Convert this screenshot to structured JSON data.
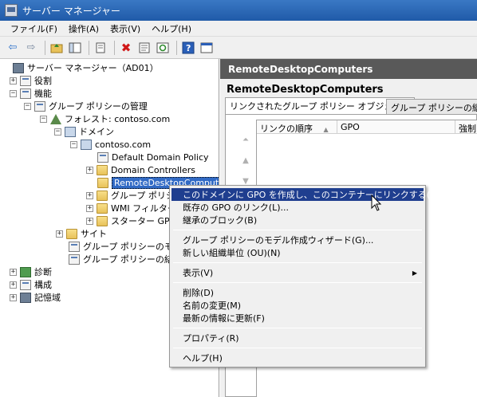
{
  "window": {
    "title": "サーバー マネージャー"
  },
  "menubar": {
    "items": [
      "ファイル(F)",
      "操作(A)",
      "表示(V)",
      "ヘルプ(H)"
    ]
  },
  "toolbar": {
    "icons": [
      "back-arrow-icon",
      "forward-arrow-icon",
      "up-folder-icon",
      "show-hide-tree-icon",
      "copy-icon",
      "delete-icon",
      "properties-icon",
      "refresh-icon",
      "help-icon",
      "console-icon"
    ]
  },
  "tree": {
    "root": "サーバー マネージャー（AD01）",
    "roles": "役割",
    "features": "機能",
    "gpm": "グループ ポリシーの管理",
    "forest": "フォレスト: contoso.com",
    "domains": "ドメイン",
    "domain": "contoso.com",
    "ddp": "Default Domain Policy",
    "dc": "Domain Controllers",
    "rdc": "RemoteDesktopComputers",
    "gpo_objects": "グループ ポリシー",
    "wmi": "WMI フィルター",
    "starter": "スターター GPO",
    "sites": "サイト",
    "modeling": "グループ ポリシーのモデ",
    "results": "グループ ポリシーの結果",
    "diagnostics": "診断",
    "configuration": "構成",
    "storage": "記憶域"
  },
  "right": {
    "header": "RemoteDesktopComputers",
    "title": "RemoteDesktopComputers",
    "tabs": [
      "リンクされたグループ ポリシー オブジェクト",
      "グループ ポリシーの継承"
    ],
    "columns": [
      "リンクの順序",
      "GPO",
      "強制"
    ]
  },
  "context_menu": {
    "items": [
      "このドメインに GPO を作成し、このコンテナーにリンクする(C)...",
      "既存の GPO のリンク(L)...",
      "継承のブロック(B)",
      "グループ ポリシーのモデル作成ウィザード(G)...",
      "新しい組織単位 (OU)(N)",
      "表示(V)",
      "削除(D)",
      "名前の変更(M)",
      "最新の情報に更新(F)",
      "プロパティ(R)",
      "ヘルプ(H)"
    ]
  },
  "colors": {
    "selection": "#316ac5",
    "menu_highlight": "#1f3e8f",
    "header": "#595959"
  }
}
